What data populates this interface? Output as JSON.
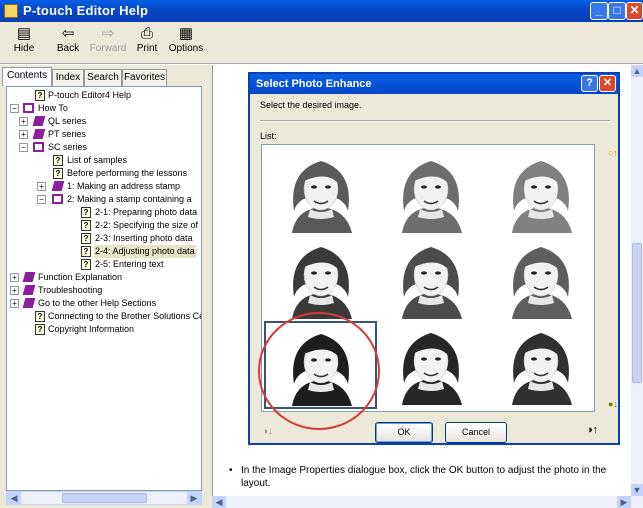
{
  "window": {
    "title": "P-touch Editor Help"
  },
  "toolbar": {
    "hide": "Hide",
    "back": "Back",
    "forward": "Forward",
    "print": "Print",
    "options": "Options"
  },
  "tabs": [
    "Contents",
    "Index",
    "Search",
    "Favorites"
  ],
  "tree": [
    {
      "label": "P-touch Editor4 Help"
    },
    {
      "label": "How To"
    },
    {
      "label": "QL series"
    },
    {
      "label": "PT series"
    },
    {
      "label": "SC series"
    },
    {
      "label": "List of samples"
    },
    {
      "label": "Before performing the lessons"
    },
    {
      "label": "1: Making an address stamp"
    },
    {
      "label": "2: Making a stamp containing a"
    },
    {
      "label": "2-1: Preparing photo data"
    },
    {
      "label": "2-2: Specifying the size of"
    },
    {
      "label": "2-3: Inserting photo data"
    },
    {
      "label": "2-4: Adjusting photo data"
    },
    {
      "label": "2-5: Entering text"
    },
    {
      "label": "Function Explanation"
    },
    {
      "label": "Troubleshooting"
    },
    {
      "label": "Go to the other Help Sections"
    },
    {
      "label": "Connecting to the Brother Solutions Ce"
    },
    {
      "label": "Copyright Information"
    }
  ],
  "dialog": {
    "title": "Select Photo Enhance",
    "instruction": "Select the desired image.",
    "list_label": "List:",
    "ok": "OK",
    "cancel": "Cancel"
  },
  "content": {
    "bullet_text": "In the Image Properties dialogue box, click the OK button to adjust the photo in the layout."
  },
  "colors": {
    "titlebar": "#0a5fe6",
    "annotation_circle": "#d63a3a"
  }
}
